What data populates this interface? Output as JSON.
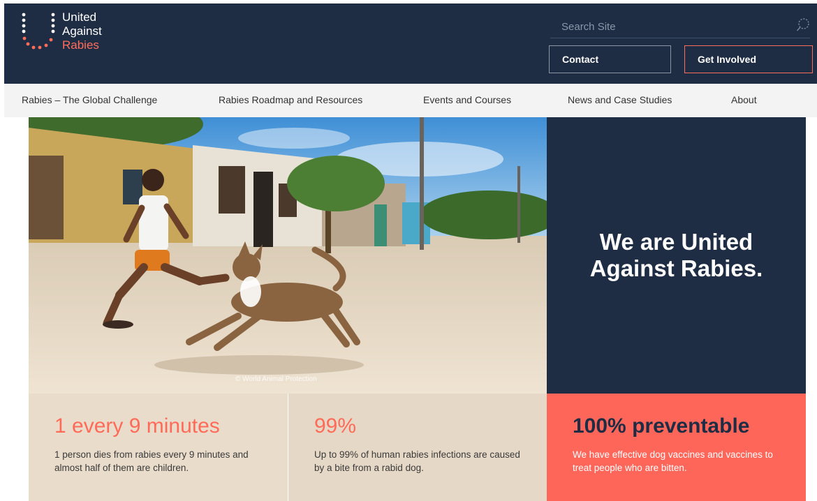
{
  "header": {
    "logo": {
      "line1": "United",
      "line2": "Against",
      "line3": "Rabies"
    },
    "search": {
      "placeholder": "Search Site",
      "value": ""
    },
    "contact_label": "Contact",
    "get_involved_label": "Get Involved"
  },
  "nav": {
    "items": [
      {
        "label": "Rabies – The Global Challenge"
      },
      {
        "label": "Rabies Roadmap and Resources"
      },
      {
        "label": "Events and Courses"
      },
      {
        "label": "News and Case Studies"
      },
      {
        "label": "About"
      }
    ]
  },
  "hero": {
    "photo_credit": "© World Animal Protection",
    "tagline": "We are United Against Rabies."
  },
  "stats": [
    {
      "title": "1 every 9 minutes",
      "text": "1 person dies from rabies every 9 minutes and almost half of them are children."
    },
    {
      "title": "99%",
      "text": "Up to 99% of human rabies infections are caused by a bite from a rabid dog."
    },
    {
      "title": "100% preventable",
      "text": "We have effective dog vaccines and vaccines to treat people who are bitten."
    }
  ],
  "colors": {
    "navy": "#1e2d44",
    "coral": "#ff6e5a",
    "nav_bg": "#f3f3f3"
  },
  "icons": {
    "search": "search-icon",
    "logo": "logo-dots-icon"
  }
}
